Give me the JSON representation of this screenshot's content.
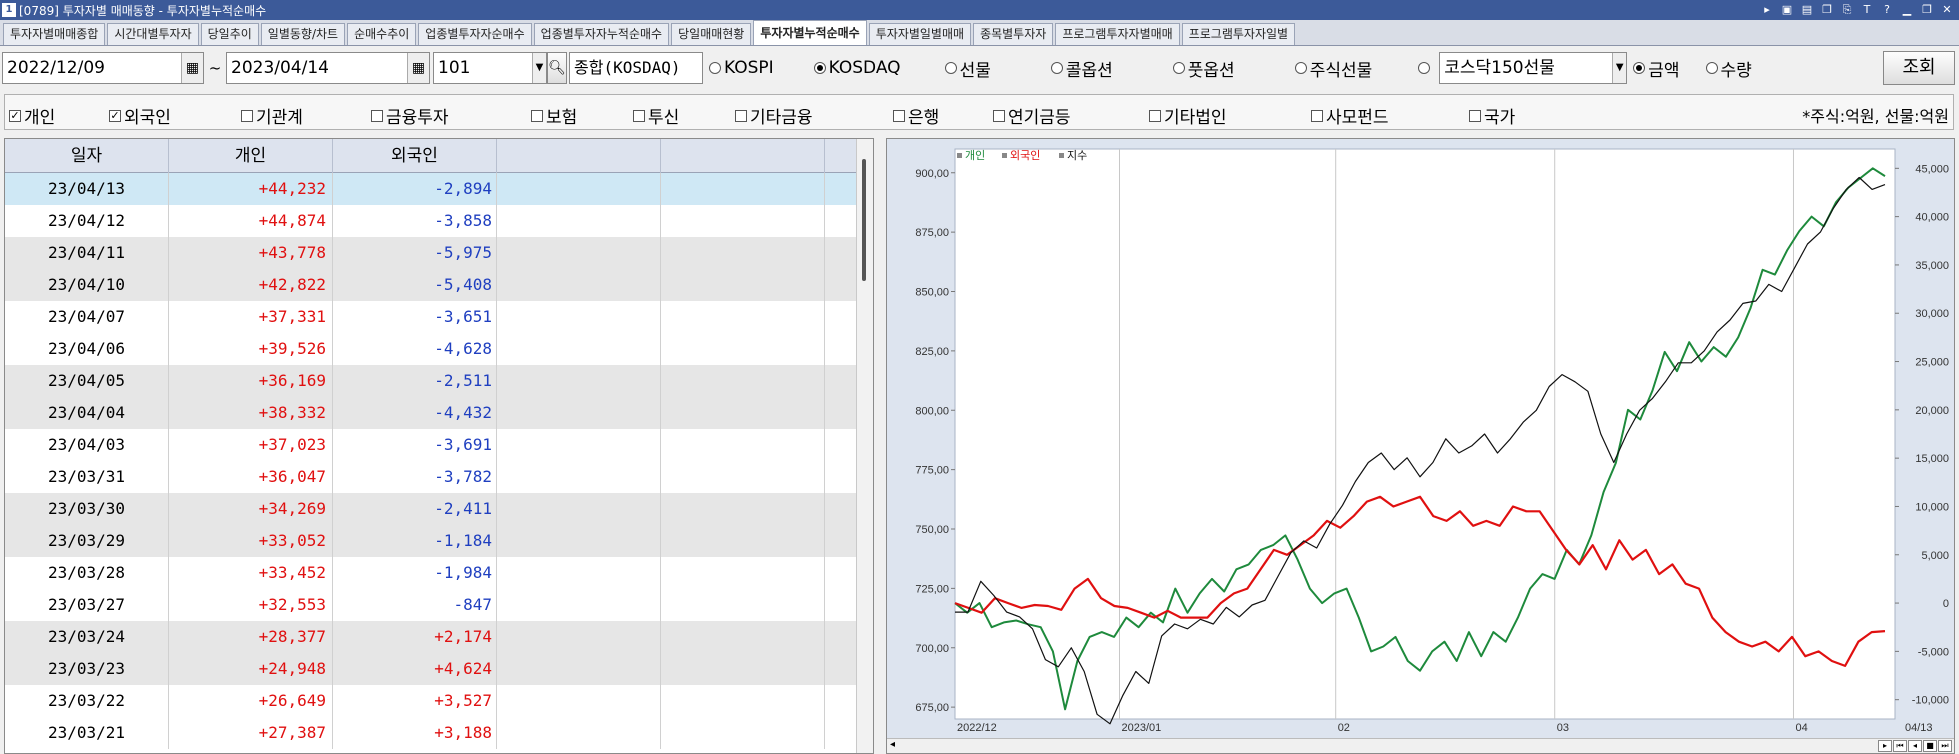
{
  "window": {
    "number": "1",
    "title": "[0789] 투자자별 매매동향 - 투자자별누적순매수"
  },
  "tabs": [
    {
      "label": "투자자별매매종합",
      "active": false
    },
    {
      "label": "시간대별투자자",
      "active": false
    },
    {
      "label": "당일추이",
      "active": false
    },
    {
      "label": "일별동향/차트",
      "active": false
    },
    {
      "label": "순매수추이",
      "active": false
    },
    {
      "label": "업종별투자자순매수",
      "active": false
    },
    {
      "label": "업종별투자자누적순매수",
      "active": false
    },
    {
      "label": "당일매매현황",
      "active": false
    },
    {
      "label": "투자자별누적순매수",
      "active": true
    },
    {
      "label": "투자자별일별매매",
      "active": false
    },
    {
      "label": "종목별투자자",
      "active": false
    },
    {
      "label": "프로그램투자자별매매",
      "active": false
    },
    {
      "label": "프로그램투자자일별",
      "active": false
    }
  ],
  "toolbar": {
    "start_date": "2022/12/09",
    "tilde": "~",
    "end_date": "2023/04/14",
    "code": "101",
    "market_name": "종합(KOSDAQ)",
    "market_radios": [
      {
        "label": "KOSPI",
        "checked": false
      },
      {
        "label": "KOSDAQ",
        "checked": true
      },
      {
        "label": "선물",
        "checked": false
      },
      {
        "label": "콜옵션",
        "checked": false
      },
      {
        "label": "풋옵션",
        "checked": false
      },
      {
        "label": "주식선물",
        "checked": false
      },
      {
        "label": "",
        "checked": false
      }
    ],
    "futures_select": "코스닥150선물",
    "amount_radios": [
      {
        "label": "금액",
        "checked": true
      },
      {
        "label": "수량",
        "checked": false
      }
    ],
    "search_button": "조회"
  },
  "investor_checks": [
    {
      "label": "개인",
      "checked": true
    },
    {
      "label": "외국인",
      "checked": true
    },
    {
      "label": "기관계",
      "checked": false
    },
    {
      "label": "금융투자",
      "checked": false
    },
    {
      "label": "보험",
      "checked": false
    },
    {
      "label": "투신",
      "checked": false
    },
    {
      "label": "기타금융",
      "checked": false
    },
    {
      "label": "은행",
      "checked": false
    },
    {
      "label": "연기금등",
      "checked": false
    },
    {
      "label": "기타법인",
      "checked": false
    },
    {
      "label": "사모펀드",
      "checked": false
    },
    {
      "label": "국가",
      "checked": false
    }
  ],
  "unit_note": "*주식:억원, 선물:억원",
  "table": {
    "headers": [
      "일자",
      "개인",
      "외국인",
      "",
      "",
      ""
    ],
    "rows": [
      {
        "date": "23/04/13",
        "individual": "+44,232",
        "foreign": "-2,894"
      },
      {
        "date": "23/04/12",
        "individual": "+44,874",
        "foreign": "-3,858"
      },
      {
        "date": "23/04/11",
        "individual": "+43,778",
        "foreign": "-5,975"
      },
      {
        "date": "23/04/10",
        "individual": "+42,822",
        "foreign": "-5,408"
      },
      {
        "date": "23/04/07",
        "individual": "+37,331",
        "foreign": "-3,651"
      },
      {
        "date": "23/04/06",
        "individual": "+39,526",
        "foreign": "-4,628"
      },
      {
        "date": "23/04/05",
        "individual": "+36,169",
        "foreign": "-2,511"
      },
      {
        "date": "23/04/04",
        "individual": "+38,332",
        "foreign": "-4,432"
      },
      {
        "date": "23/04/03",
        "individual": "+37,023",
        "foreign": "-3,691"
      },
      {
        "date": "23/03/31",
        "individual": "+36,047",
        "foreign": "-3,782"
      },
      {
        "date": "23/03/30",
        "individual": "+34,269",
        "foreign": "-2,411"
      },
      {
        "date": "23/03/29",
        "individual": "+33,052",
        "foreign": "-1,184"
      },
      {
        "date": "23/03/28",
        "individual": "+33,452",
        "foreign": "-1,984"
      },
      {
        "date": "23/03/27",
        "individual": "+32,553",
        "foreign": "-847"
      },
      {
        "date": "23/03/24",
        "individual": "+28,377",
        "foreign": "+2,174"
      },
      {
        "date": "23/03/23",
        "individual": "+24,948",
        "foreign": "+4,624"
      },
      {
        "date": "23/03/22",
        "individual": "+26,649",
        "foreign": "+3,527"
      },
      {
        "date": "23/03/21",
        "individual": "+27,387",
        "foreign": "+3,188"
      }
    ]
  },
  "chart_data": {
    "type": "line",
    "legend": [
      "개인",
      "외국인",
      "지수"
    ],
    "x_ticks": [
      "2022/12",
      "2023/01",
      "02",
      "03",
      "04",
      "04/13"
    ],
    "y_left_ticks": [
      "900,00",
      "875,00",
      "850,00",
      "825,00",
      "800,00",
      "775,00",
      "750,00",
      "725,00",
      "700,00",
      "675,00"
    ],
    "y_left_range": [
      670,
      910
    ],
    "y_right_ticks": [
      "45,000",
      "40,000",
      "35,000",
      "30,000",
      "25,000",
      "20,000",
      "15,000",
      "10,000",
      "5,000",
      "0",
      "-5,000",
      "-10,000"
    ],
    "y_right_range": [
      -12000,
      47000
    ],
    "colors": {
      "individual": "#1e8a3c",
      "foreign": "#e01010",
      "index": "#111111"
    },
    "series": [
      {
        "name": "개인",
        "axis": "right",
        "values": [
          0,
          -1000,
          0,
          -2500,
          -2000,
          -1800,
          -2200,
          -2500,
          -5000,
          -11000,
          -6000,
          -3500,
          -3000,
          -3500,
          -1500,
          -2500,
          -1000,
          -2000,
          1500,
          -1000,
          1000,
          2500,
          1200,
          3500,
          4000,
          5500,
          6000,
          7000,
          4500,
          1500,
          0,
          1000,
          1500,
          -1500,
          -5000,
          -4500,
          -3500,
          -6000,
          -7000,
          -5000,
          -4000,
          -6000,
          -3000,
          -5500,
          -3000,
          -4000,
          -1500,
          1500,
          3000,
          2500,
          5500,
          4000,
          7000,
          11500,
          14500,
          20000,
          19000,
          22000,
          26000,
          24000,
          27000,
          25000,
          26500,
          25500,
          27500,
          30500,
          34500,
          34000,
          36500,
          38500,
          40000,
          39000,
          41500,
          43000,
          44000,
          45000,
          44200
        ]
      },
      {
        "name": "외국인",
        "axis": "right",
        "values": [
          0,
          -500,
          -1000,
          500,
          0,
          -500,
          -200,
          -300,
          -700,
          1500,
          2500,
          500,
          -300,
          -500,
          -1000,
          -1500,
          -800,
          -1500,
          -1500,
          -1500,
          0,
          1000,
          1500,
          3500,
          5500,
          5000,
          6000,
          7000,
          8500,
          7800,
          9000,
          10500,
          11000,
          10000,
          10500,
          11000,
          9000,
          8500,
          9500,
          8000,
          8500,
          8000,
          10000,
          9500,
          9500,
          7500,
          5500,
          4000,
          6000,
          3500,
          6500,
          4500,
          5500,
          3000,
          4000,
          2000,
          1500,
          -1500,
          -3000,
          -4000,
          -4500,
          -4000,
          -5000,
          -3500,
          -5500,
          -5000,
          -6000,
          -6500,
          -4000,
          -3000,
          -2900
        ]
      },
      {
        "name": "지수",
        "axis": "left",
        "values": [
          715,
          715,
          728,
          722,
          715,
          713,
          708,
          695,
          692,
          700,
          690,
          672,
          668,
          680,
          690,
          685,
          705,
          710,
          708,
          712,
          710,
          717,
          713,
          718,
          720,
          730,
          740,
          745,
          742,
          752,
          760,
          770,
          778,
          782,
          775,
          780,
          772,
          778,
          788,
          782,
          785,
          790,
          782,
          788,
          795,
          800,
          810,
          815,
          812,
          808,
          790,
          778,
          790,
          800,
          805,
          812,
          820,
          820,
          825,
          833,
          838,
          845,
          846,
          853,
          850,
          860,
          870,
          875,
          885,
          893,
          898,
          893,
          895
        ]
      }
    ]
  }
}
